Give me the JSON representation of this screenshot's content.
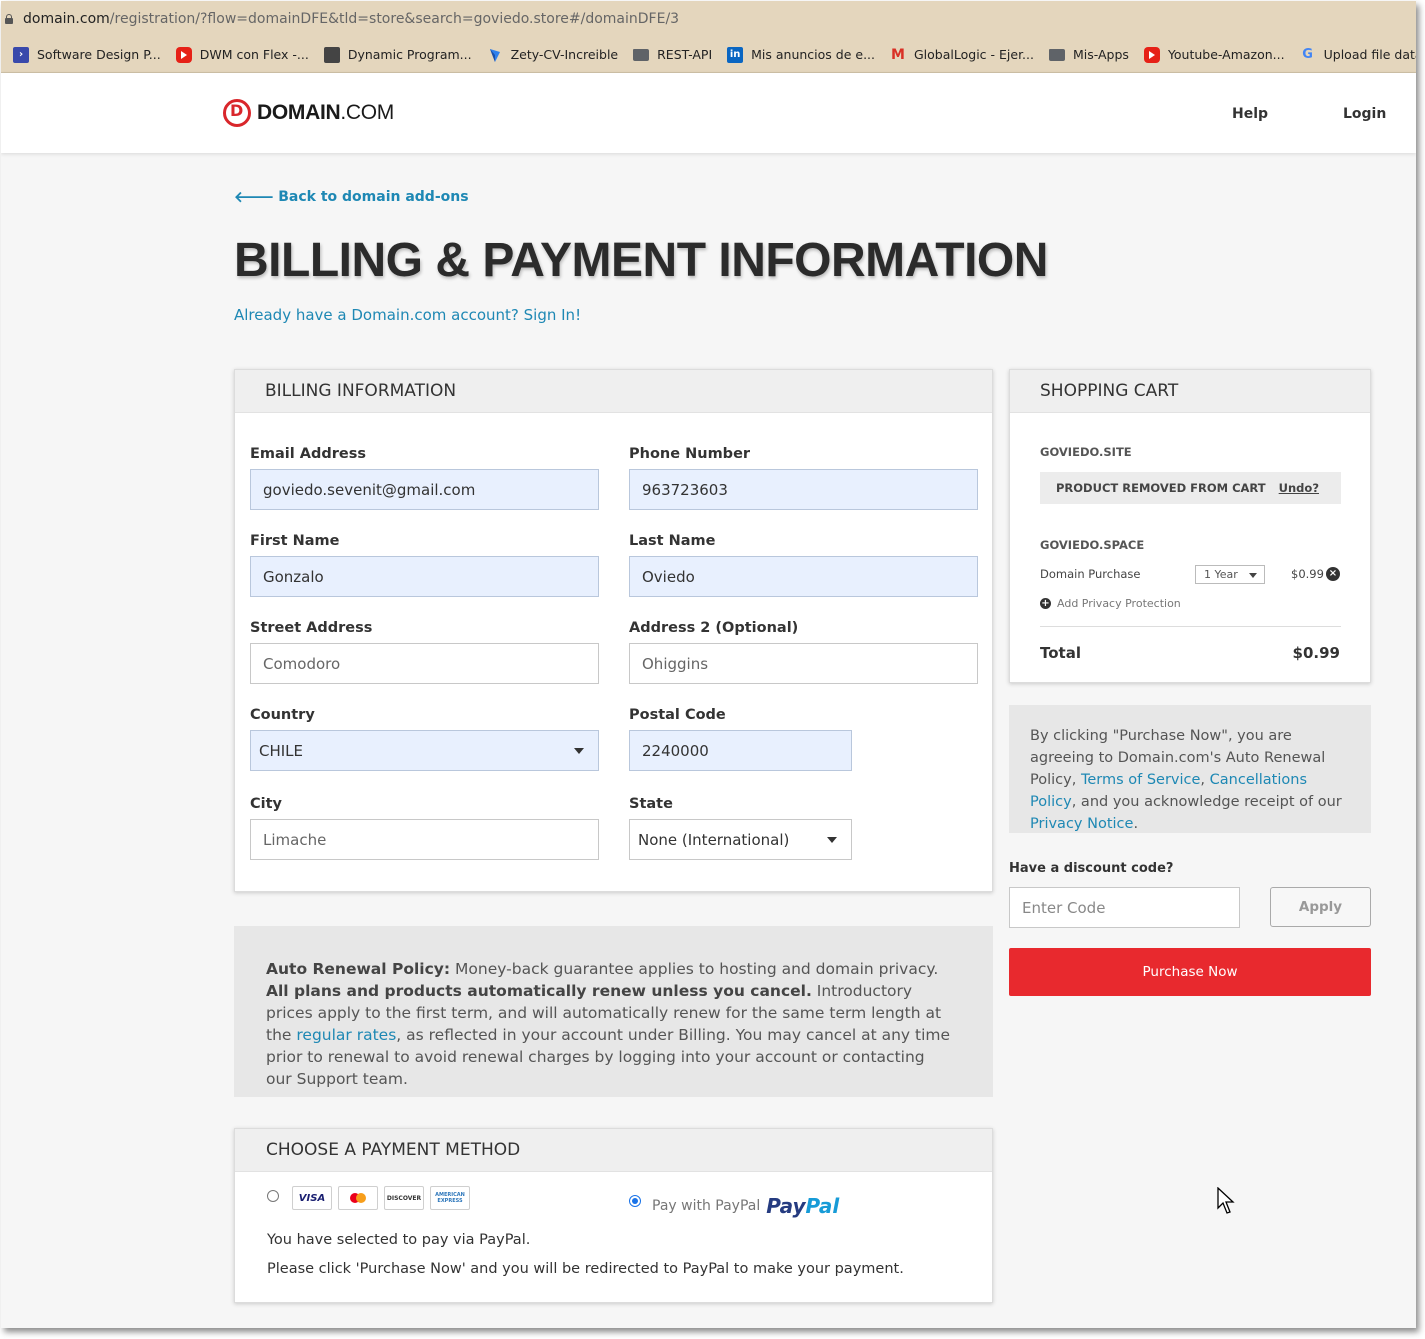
{
  "browser": {
    "url_host": "domain.com",
    "url_path": "/registration/?flow=domainDFE&tld=store&search=goviedo.store#/domainDFE/3",
    "bookmarks": [
      {
        "label": "Software Design P...",
        "icon": "terminal-icon"
      },
      {
        "label": "DWM con Flex -...",
        "icon": "youtube-icon"
      },
      {
        "label": "Dynamic Program...",
        "icon": "page-icon"
      },
      {
        "label": "Zety-CV-Increible",
        "icon": "zety-icon"
      },
      {
        "label": "REST-API",
        "icon": "folder-icon"
      },
      {
        "label": "Mis anuncios de e...",
        "icon": "linkedin-icon"
      },
      {
        "label": "GlobalLogic - Ejer...",
        "icon": "gmail-icon"
      },
      {
        "label": "Mis-Apps",
        "icon": "folder-icon"
      },
      {
        "label": "Youtube-Amazon...",
        "icon": "youtube-icon"
      },
      {
        "label": "Upload file data |...",
        "icon": "google-icon"
      }
    ]
  },
  "header": {
    "logo_main": "DOMAIN",
    "logo_suffix": ".COM",
    "help": "Help",
    "login": "Login"
  },
  "page": {
    "back_link": "Back to domain add-ons",
    "title": "BILLING & PAYMENT INFORMATION",
    "signin_prompt": "Already have a Domain.com account? Sign In!"
  },
  "billing": {
    "heading": "BILLING INFORMATION",
    "fields": {
      "email": {
        "label": "Email Address",
        "value": "goviedo.sevenit@gmail.com"
      },
      "phone": {
        "label": "Phone Number",
        "value": "963723603"
      },
      "first_name": {
        "label": "First Name",
        "value": "Gonzalo"
      },
      "last_name": {
        "label": "Last Name",
        "value": "Oviedo"
      },
      "street": {
        "label": "Street Address",
        "value": "Comodoro"
      },
      "address2": {
        "label": "Address 2 (Optional)",
        "value": "Ohiggins"
      },
      "country": {
        "label": "Country",
        "value": "CHILE"
      },
      "postal": {
        "label": "Postal Code",
        "value": "2240000"
      },
      "city": {
        "label": "City",
        "value": "Limache"
      },
      "state": {
        "label": "State",
        "value": "None (International)"
      }
    }
  },
  "cart": {
    "heading": "SHOPPING CART",
    "removed_domain": "GOVIEDO.SITE",
    "removed_msg": "PRODUCT REMOVED FROM CART",
    "undo": "Undo?",
    "domain": "GOVIEDO.SPACE",
    "item_label": "Domain Purchase",
    "term": "1 Year",
    "price": "$0.99",
    "add_privacy": "Add Privacy Protection",
    "total_label": "Total",
    "total_value": "$0.99"
  },
  "agreement": {
    "pre": "By clicking \"Purchase Now\", you are agreeing to Domain.com's Auto Renewal Policy, ",
    "terms": "Terms of Service",
    "comma": ", ",
    "cancel": "Cancellations Policy",
    "mid": ", and you acknowledge receipt of our ",
    "privacy": "Privacy Notice",
    "end": "."
  },
  "discount": {
    "label": "Have a discount code?",
    "placeholder": "Enter Code",
    "apply": "Apply"
  },
  "purchase_button": "Purchase Now",
  "auto_renewal": {
    "bold_label": "Auto Renewal Policy:",
    "text1": " Money-back guarantee applies to hosting and domain privacy. ",
    "bold2": "All plans and products automatically renew unless you cancel.",
    "text2": " Introductory prices apply to the first term, and will automatically renew for the same term length at the ",
    "link": "regular rates",
    "text3": ", as reflected in your account under Billing. You may cancel at any time prior to renewal to avoid renewal charges by logging into your account or contacting our Support team."
  },
  "payment": {
    "heading": "CHOOSE A PAYMENT METHOD",
    "cards": [
      "VISA",
      "MasterCard",
      "DISCOVER",
      "AMERICAN EXPRESS"
    ],
    "paypal_label": "Pay with PayPal",
    "paypal_logo_1": "Pay",
    "paypal_logo_2": "Pal",
    "selected_method": "paypal",
    "msg1": "You have selected to pay via PayPal.",
    "msg2": "Please click 'Purchase Now' and you will be redirected to PayPal to make your payment."
  },
  "colors": {
    "accent_link": "#1e88b4",
    "purchase_red": "#e8292e",
    "browser_chrome": "#e4d6bd"
  }
}
